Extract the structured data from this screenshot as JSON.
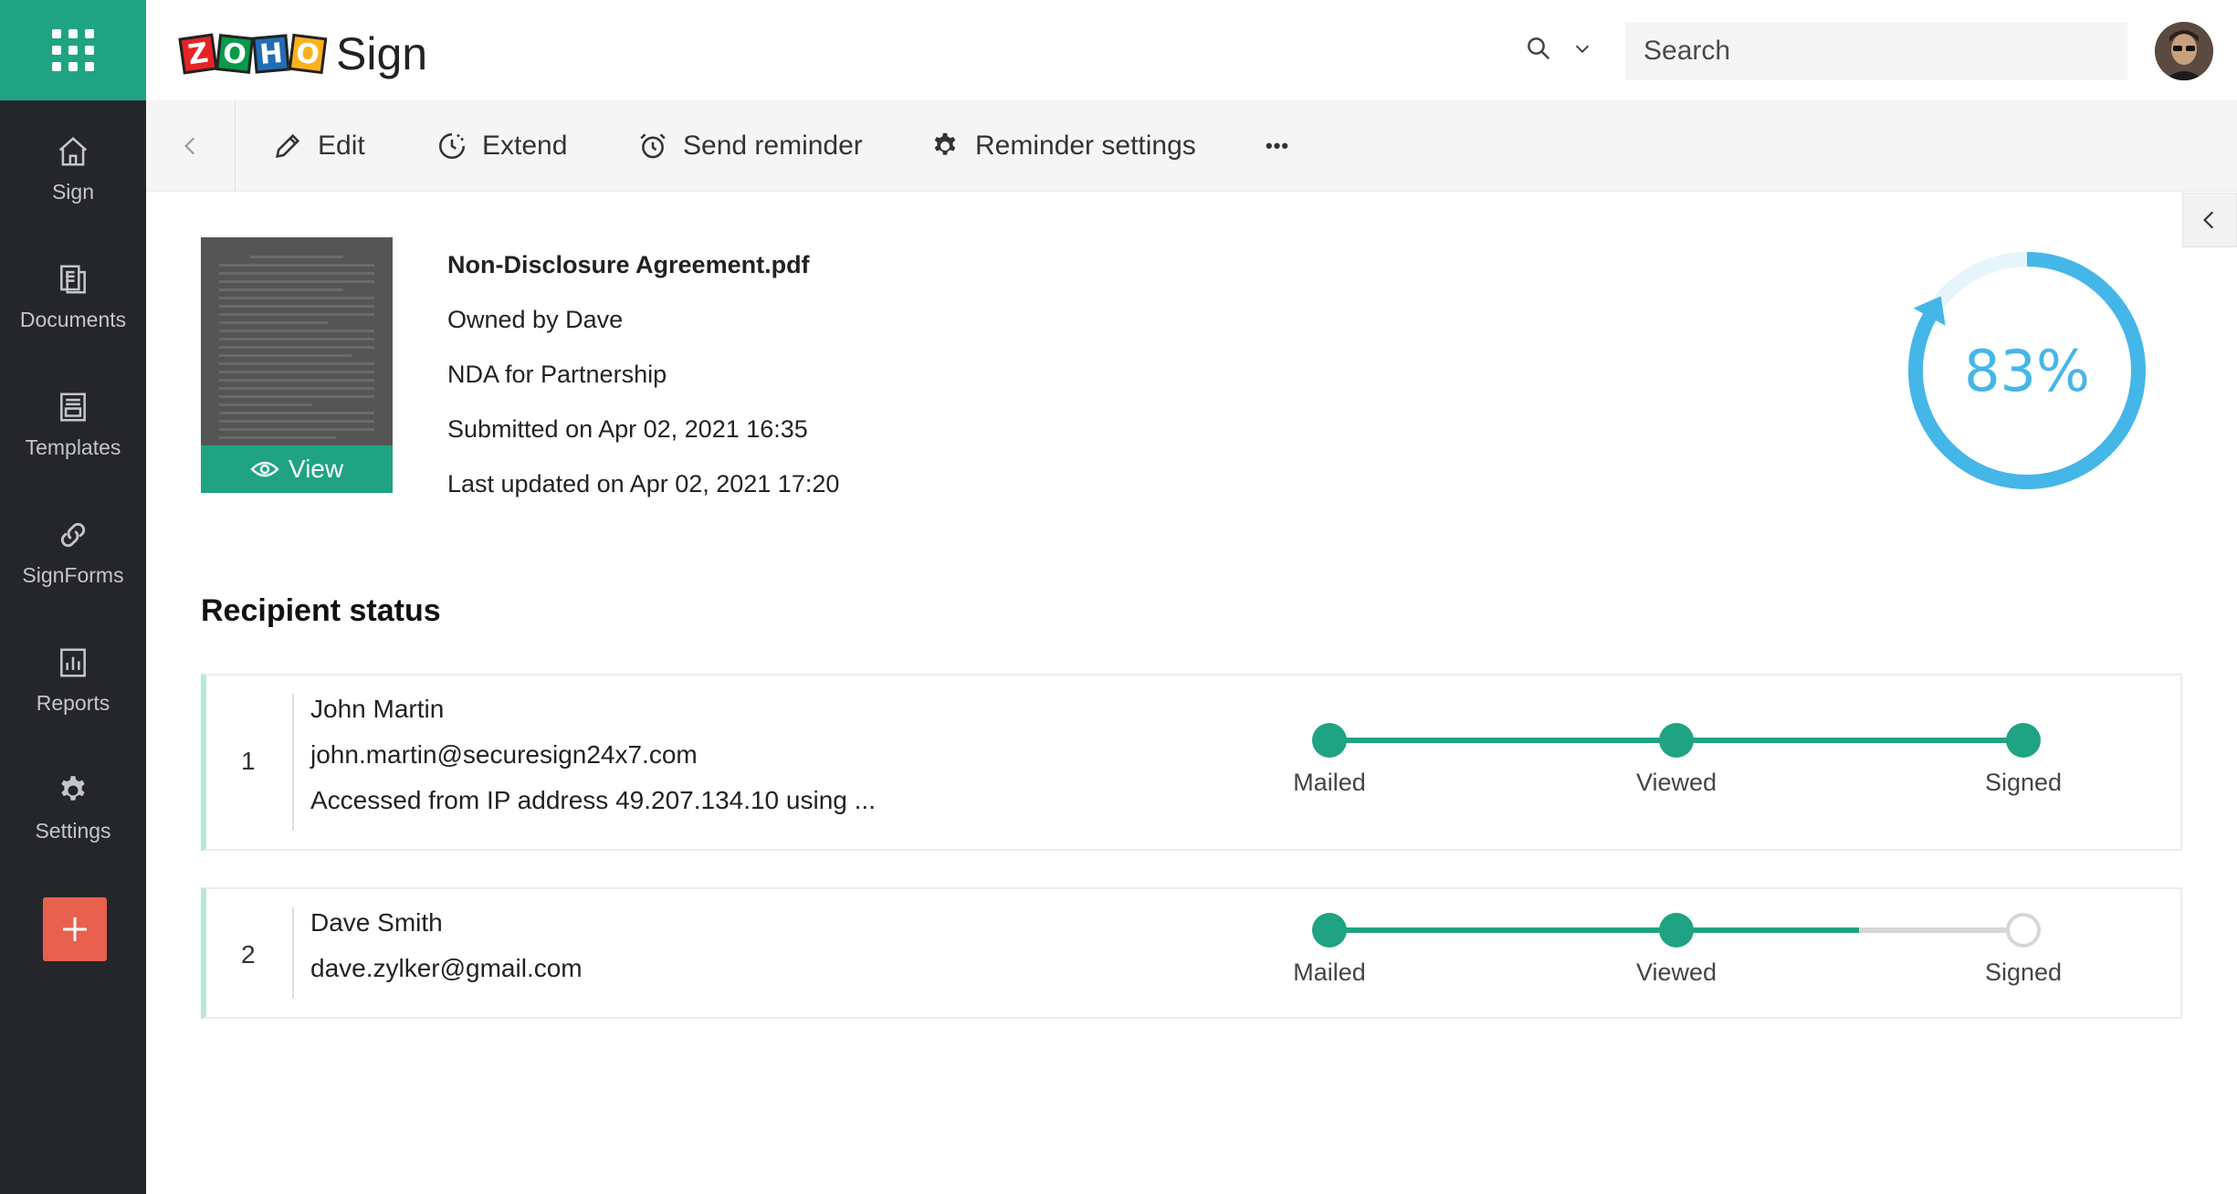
{
  "app": {
    "logo_letters": [
      "Z",
      "O",
      "H",
      "O"
    ],
    "logo_colors": [
      "#e42527",
      "#089949",
      "#226db4",
      "#f9b21d"
    ],
    "product_name": "Sign",
    "accent_color": "#1fa383"
  },
  "sidebar": {
    "items": [
      {
        "label": "Sign",
        "icon": "home-icon"
      },
      {
        "label": "Documents",
        "icon": "documents-icon"
      },
      {
        "label": "Templates",
        "icon": "templates-icon"
      },
      {
        "label": "SignForms",
        "icon": "link-icon"
      },
      {
        "label": "Reports",
        "icon": "reports-icon"
      },
      {
        "label": "Settings",
        "icon": "gear-icon"
      }
    ],
    "add_label": "+"
  },
  "header": {
    "search_placeholder": "Search"
  },
  "toolbar": {
    "edit": "Edit",
    "extend": "Extend",
    "send_reminder": "Send reminder",
    "reminder_settings": "Reminder settings",
    "more": "•••"
  },
  "document": {
    "name": "Non-Disclosure Agreement.pdf",
    "owner": "Owned by Dave",
    "description": "NDA for Partnership",
    "submitted": "Submitted on Apr 02, 2021 16:35",
    "updated": "Last updated on Apr 02, 2021 17:20",
    "view_label": "View",
    "progress_percent": 83,
    "progress_label": "83%",
    "progress_color": "#45b6e8"
  },
  "recipients_section": {
    "title": "Recipient status",
    "recipients": [
      {
        "number": "1",
        "name": "John Martin",
        "email": "john.martin@securesign24x7.com",
        "access": "Accessed from IP address 49.207.134.10 using ...",
        "stages": [
          "Mailed",
          "Viewed",
          "Signed"
        ],
        "completed": [
          true,
          true,
          true
        ]
      },
      {
        "number": "2",
        "name": "Dave Smith",
        "email": "dave.zylker@gmail.com",
        "stages": [
          "Mailed",
          "Viewed",
          "Signed"
        ],
        "completed": [
          true,
          true,
          false
        ]
      }
    ]
  }
}
